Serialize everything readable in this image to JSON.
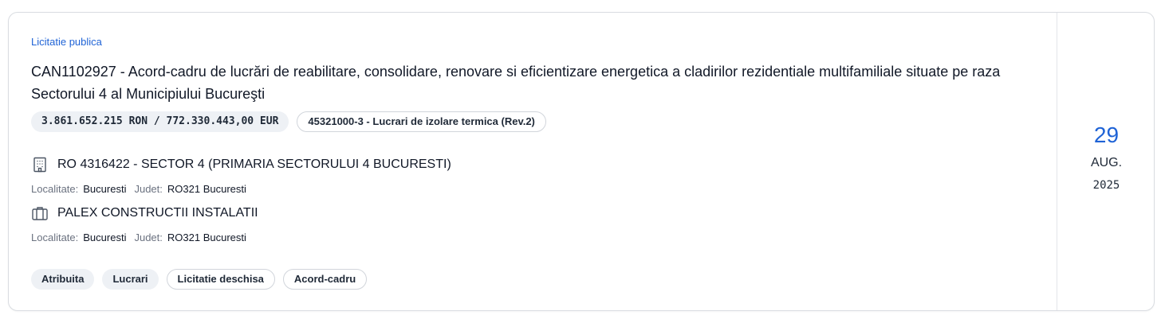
{
  "procedure": {
    "category": "Licitatie publica",
    "title": "CAN1102927 - Acord-cadru de lucrări de reabilitare, consolidare, renovare si eficientizare energetica a cladirilor rezidentiale multifamiliale situate pe raza Sectorului 4 al Municipiului Bucureşti",
    "value": "3.861.652.215 RON / 772.330.443,00 EUR",
    "cpv": "45321000-3 - Lucrari de izolare termica (Rev.2)"
  },
  "authority": {
    "icon": "building-icon",
    "name": "RO 4316422 - SECTOR 4 (PRIMARIA SECTORULUI 4 BUCURESTI)",
    "locality_label": "Localitate:",
    "locality": "Bucuresti",
    "county_label": "Judet:",
    "county": "RO321 Bucuresti"
  },
  "winner": {
    "icon": "briefcase-icon",
    "name": "PALEX CONSTRUCTII INSTALATII",
    "locality_label": "Localitate:",
    "locality": "Bucuresti",
    "county_label": "Judet:",
    "county": "RO321 Bucuresti"
  },
  "tags": [
    "Atribuita",
    "Lucrari",
    "Licitatie deschisa",
    "Acord-cadru"
  ],
  "date": {
    "day": "29",
    "month": "AUG.",
    "year": "2025"
  },
  "colors": {
    "accent": "#1f63d6",
    "pill_bg": "#eef1f5",
    "border": "#d9dce1"
  }
}
